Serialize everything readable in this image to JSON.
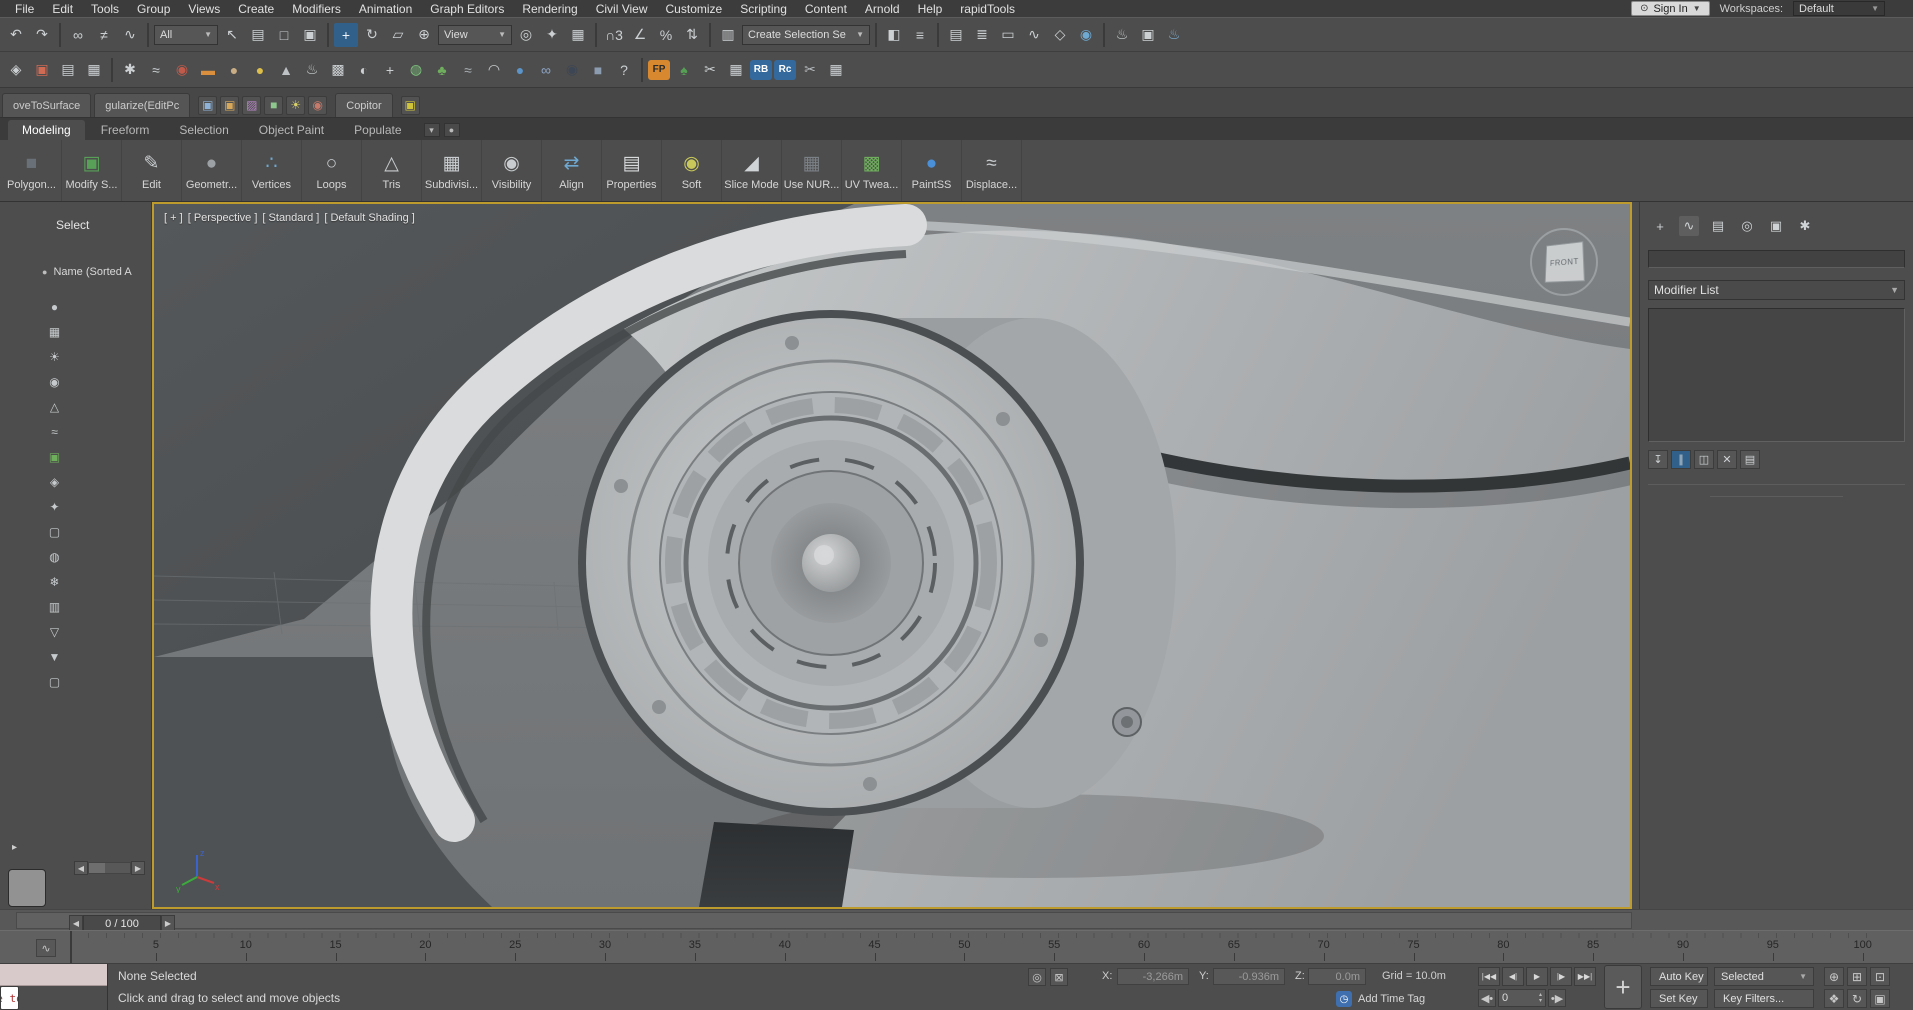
{
  "menu_bar": {
    "items": [
      "File",
      "Edit",
      "Tools",
      "Group",
      "Views",
      "Create",
      "Modifiers",
      "Animation",
      "Graph Editors",
      "Rendering",
      "Civil View",
      "Customize",
      "Scripting",
      "Content",
      "Arnold",
      "Help",
      "rapidTools"
    ],
    "sign_in_label": "Sign In",
    "workspaces_label": "Workspaces:",
    "workspace_value": "Default"
  },
  "toolbar_row1": {
    "icons_a": [
      {
        "name": "undo-icon",
        "glyph": "↶"
      },
      {
        "name": "redo-icon",
        "glyph": "↷"
      },
      {
        "name": "separator",
        "kind": "sep",
        "inter": "false"
      },
      {
        "name": "select-and-link-icon",
        "glyph": "∞"
      },
      {
        "name": "unlink-selection-icon",
        "glyph": "≠"
      },
      {
        "name": "bind-to-space-warp-icon",
        "glyph": "∿"
      },
      {
        "name": "separator",
        "kind": "sep",
        "inter": "false"
      }
    ],
    "filter_dropdown_value": "All",
    "icons_b": [
      {
        "name": "select-object-icon",
        "glyph": "↖"
      },
      {
        "name": "select-by-name-icon",
        "glyph": "▤"
      },
      {
        "name": "rectangular-selection-region-icon",
        "glyph": "□"
      },
      {
        "name": "window-crossing-icon",
        "glyph": "▣"
      },
      {
        "name": "separator",
        "kind": "sep",
        "inter": "false"
      },
      {
        "name": "select-and-move-icon",
        "glyph": "+",
        "kind": "hl"
      },
      {
        "name": "select-and-rotate-icon",
        "glyph": "↻"
      },
      {
        "name": "select-and-scale-icon",
        "glyph": "▱"
      },
      {
        "name": "select-and-place-icon",
        "glyph": "⊕"
      }
    ],
    "coord_dropdown_value": "View",
    "icons_c": [
      {
        "name": "use-pivot-center-icon",
        "glyph": "◎"
      },
      {
        "name": "select-and-manipulate-icon",
        "glyph": "✦"
      },
      {
        "name": "keyboard-override-icon",
        "glyph": "▦"
      },
      {
        "name": "separator",
        "kind": "sep",
        "inter": "false"
      },
      {
        "name": "snaps-toggle-icon",
        "glyph": "∩3"
      },
      {
        "name": "angle-snap-icon",
        "glyph": "∠"
      },
      {
        "name": "percent-snap-icon",
        "glyph": "%"
      },
      {
        "name": "spinner-snap-icon",
        "glyph": "⇅"
      },
      {
        "name": "separator",
        "kind": "sep",
        "inter": "false"
      },
      {
        "name": "edit-named-selection-sets-icon",
        "glyph": "▥"
      }
    ],
    "sets_dropdown_value": "Create Selection Se",
    "icons_d": [
      {
        "name": "separator",
        "kind": "sep",
        "inter": "false"
      },
      {
        "name": "mirror-icon",
        "glyph": "◧"
      },
      {
        "name": "align-icon",
        "glyph": "≡"
      },
      {
        "name": "separator",
        "kind": "sep",
        "inter": "false"
      },
      {
        "name": "scene-explorer-toggle-icon",
        "glyph": "▤"
      },
      {
        "name": "layer-explorer-toggle-icon",
        "glyph": "≣"
      },
      {
        "name": "ribbon-toggle-icon",
        "glyph": "▭"
      },
      {
        "name": "curve-editor-icon",
        "glyph": "∿"
      },
      {
        "name": "schematic-view-icon",
        "glyph": "◇"
      },
      {
        "name": "material-editor-icon",
        "glyph": "◉",
        "style": "color:#6fa8d0"
      },
      {
        "name": "separator",
        "kind": "sep",
        "inter": "false"
      },
      {
        "name": "render-setup-icon",
        "glyph": "♨"
      },
      {
        "name": "rendered-frame-icon",
        "glyph": "▣"
      },
      {
        "name": "render-production-icon",
        "glyph": "♨",
        "style": "color:#7fb3d8"
      }
    ]
  },
  "toolbar_row2": {
    "icons": [
      {
        "name": "snapshot-icon",
        "glyph": "◈"
      },
      {
        "name": "image-viewer-icon",
        "glyph": "▣",
        "style": "color:#cf6a55"
      },
      {
        "name": "grid-array-icon",
        "glyph": "▤"
      },
      {
        "name": "data-table-icon",
        "glyph": "▦"
      },
      {
        "name": "separator",
        "kind": "sep",
        "inter": "false"
      },
      {
        "name": "gear-icon",
        "glyph": "✱"
      },
      {
        "name": "particles-icon",
        "glyph": "≈"
      },
      {
        "name": "camera-icon",
        "glyph": "◉",
        "style": "color:#c05a4a"
      },
      {
        "name": "rectangle-shape-icon",
        "glyph": "▬",
        "style": "color:#d98f3e"
      },
      {
        "name": "sphere-shape-icon",
        "glyph": "●",
        "style": "color:#c9ad85"
      },
      {
        "name": "circle-shape-icon",
        "glyph": "●",
        "style": "color:#ddbe4a"
      },
      {
        "name": "cone-shape-icon",
        "glyph": "▲",
        "style": "color:#bfc2c4"
      },
      {
        "name": "teapot-icon",
        "glyph": "♨"
      },
      {
        "name": "lattice-icon",
        "glyph": "▩"
      },
      {
        "name": "dark-sphere-icon",
        "glyph": "◐"
      },
      {
        "name": "axis-gizmo-icon",
        "glyph": "+"
      },
      {
        "name": "globe-icon",
        "glyph": "◍",
        "style": "color:#7ec37e"
      },
      {
        "name": "plant-icon",
        "glyph": "♣",
        "style": "color:#6fae5d"
      },
      {
        "name": "smoke-icon",
        "glyph": "≈",
        "style": "color:#aab0b4"
      },
      {
        "name": "swirl-icon",
        "glyph": "◠"
      },
      {
        "name": "blue-sphere-icon",
        "glyph": "●",
        "style": "color:#5b94c8"
      },
      {
        "name": "chain-icon",
        "glyph": "∞",
        "style": "color:#8fa6c8"
      },
      {
        "name": "eye-icon",
        "glyph": "◉",
        "style": "color:#3c4654"
      },
      {
        "name": "cube-icon",
        "glyph": "■",
        "style": "color:#8b9bb0"
      },
      {
        "name": "help-icon",
        "glyph": "?"
      },
      {
        "name": "separator",
        "kind": "sep",
        "inter": "false"
      },
      {
        "name": "forest-pack-badge",
        "kind": "badge",
        "glyph": "FP",
        "style": "background:#d8882f;color:#2b2b2b"
      },
      {
        "name": "tree-icon",
        "glyph": "♠",
        "style": "color:#55a055"
      },
      {
        "name": "scissors-icon",
        "glyph": "✂"
      },
      {
        "name": "uv-grid-icon",
        "glyph": "▦"
      },
      {
        "name": "railclone-badge",
        "kind": "badge",
        "glyph": "RB",
        "style": "background:#34699e;color:#ffffff"
      },
      {
        "name": "railclone-color-badge",
        "kind": "badge",
        "glyph": "Rc",
        "style": "background:#34699e;color:#ffffff"
      },
      {
        "name": "cutter-icon",
        "glyph": "✂",
        "style": "color:#b8bcbe"
      },
      {
        "name": "spreadsheet-icon",
        "glyph": "▦"
      }
    ]
  },
  "tab_bar": {
    "doc_tabs": [
      {
        "name": "tab-movetosurface",
        "label": "oveToSurface"
      },
      {
        "name": "tab-regularize-editpoly",
        "label": "gularize(EditPc"
      }
    ],
    "tool_icons": [
      {
        "name": "copy-tool-icon",
        "glyph": "▣",
        "style": "color:#8fb3d8"
      },
      {
        "name": "paste-tool-icon",
        "glyph": "▣",
        "style": "color:#d8a85a"
      },
      {
        "name": "material-tool-icon",
        "glyph": "▨",
        "style": "color:#b886c8"
      },
      {
        "name": "geometry-tool-icon",
        "glyph": "■",
        "style": "color:#8fc88f"
      },
      {
        "name": "light-tool-icon",
        "glyph": "☀",
        "style": "color:#d8d06a"
      },
      {
        "name": "camera-tool-icon",
        "glyph": "◉",
        "style": "color:#c87a6a"
      }
    ],
    "copitor_tab_label": "Copitor",
    "trailing_icons": [
      {
        "name": "textool-icon",
        "glyph": "▣",
        "style": "color:#cfc43a"
      }
    ]
  },
  "ribbon": {
    "tabs": [
      {
        "label": "Modeling",
        "state": "active"
      },
      {
        "label": "Freeform"
      },
      {
        "label": "Selection"
      },
      {
        "label": "Object Paint"
      },
      {
        "label": "Populate"
      }
    ],
    "options_icon_glyph": "▾",
    "minimize_icon_glyph": "●",
    "buttons": [
      {
        "name": "ribbon-button-polygon",
        "label": "Polygon...",
        "glyph": "■",
        "style": "color:#6a7077"
      },
      {
        "name": "ribbon-button-modify-selection",
        "label": "Modify S...",
        "glyph": "▣",
        "style": "color:#58a058"
      },
      {
        "name": "ribbon-button-edit",
        "label": "Edit",
        "glyph": "✎",
        "style": "color:#c8ccce"
      },
      {
        "name": "ribbon-button-geometry",
        "label": "Geometr...",
        "glyph": "●",
        "style": "color:#9ba1a5"
      },
      {
        "name": "ribbon-button-vertices",
        "label": "Vertices",
        "glyph": "∴",
        "style": "color:#6fa8d0"
      },
      {
        "name": "ribbon-button-loops",
        "label": "Loops",
        "glyph": "○",
        "style": "color:#c8ccce"
      },
      {
        "name": "ribbon-button-tris",
        "label": "Tris",
        "glyph": "△",
        "style": "color:#c8ccce"
      },
      {
        "name": "ribbon-button-subdivision",
        "label": "Subdivisi...",
        "glyph": "▦",
        "style": "color:#c8ccce"
      },
      {
        "name": "ribbon-button-visibility",
        "label": "Visibility",
        "glyph": "◉",
        "style": "color:#c8ccce"
      },
      {
        "name": "ribbon-button-align",
        "label": "Align",
        "glyph": "⇄",
        "style": "color:#6fa8d0"
      },
      {
        "name": "ribbon-button-properties",
        "label": "Properties",
        "glyph": "▤",
        "style": "color:#d8dadc"
      },
      {
        "name": "ribbon-button-soft",
        "label": "Soft",
        "glyph": "◉",
        "style": "color:#c8c85a"
      },
      {
        "name": "ribbon-button-slice-mode",
        "label": "Slice Mode",
        "glyph": "◢",
        "style": "color:#d0d4d6"
      },
      {
        "name": "ribbon-button-use-nurms",
        "label": "Use NUR...",
        "glyph": "▦",
        "style": "color:#7a8086"
      },
      {
        "name": "ribbon-button-uv-tweak",
        "label": "UV Twea...",
        "glyph": "▩",
        "style": "color:#6fae5d"
      },
      {
        "name": "ribbon-button-paintss",
        "label": "PaintSS",
        "glyph": "●",
        "style": "color:#4a90d9"
      },
      {
        "name": "ribbon-button-displace",
        "label": "Displace...",
        "glyph": "≈",
        "style": "color:#c8ccce"
      }
    ]
  },
  "scene_explorer": {
    "title": "Select",
    "header_dot_glyph": "●",
    "column_header": "Name (Sorted A",
    "rail_icons": [
      {
        "name": "sort-icon",
        "glyph": "●"
      },
      {
        "name": "display-geometry-icon",
        "glyph": "▦"
      },
      {
        "name": "display-lights-icon",
        "glyph": "☀"
      },
      {
        "name": "display-cameras-icon",
        "glyph": "◉"
      },
      {
        "name": "display-helpers-icon",
        "glyph": "△"
      },
      {
        "name": "display-spacewarps-icon",
        "glyph": "≈"
      },
      {
        "name": "display-groups-icon",
        "glyph": "▣",
        "style": "color:#6fae5d"
      },
      {
        "name": "display-xrefs-icon",
        "glyph": "◈"
      },
      {
        "name": "display-bones-icon",
        "glyph": "✦"
      },
      {
        "name": "display-containers-icon",
        "glyph": "▢"
      },
      {
        "name": "display-materials-icon",
        "glyph": "◍"
      },
      {
        "name": "display-frozen-icon",
        "glyph": "❄"
      },
      {
        "name": "display-hidden-icon",
        "glyph": "▥"
      },
      {
        "name": "funnel-filter-icon",
        "glyph": "▽"
      },
      {
        "name": "filter-config-icon",
        "glyph": "▼"
      },
      {
        "name": "pin-explorer-icon",
        "glyph": "▢"
      }
    ],
    "flyout_glyph": "▸",
    "scroll_left_glyph": "◀",
    "scroll_right_glyph": "▶"
  },
  "viewport": {
    "label_plus": "+",
    "label_view": "Perspective",
    "label_renderer": "Standard",
    "label_shading": "Default Shading",
    "viewcube_face": "FRONT",
    "axis_x": "x",
    "axis_y": "y",
    "axis_z": "z"
  },
  "command_panel": {
    "tabs": [
      {
        "name": "create-tab",
        "glyph": "+"
      },
      {
        "name": "modify-tab",
        "glyph": "∿",
        "state": "active"
      },
      {
        "name": "hierarchy-tab",
        "glyph": "▤"
      },
      {
        "name": "motion-tab",
        "glyph": "◎"
      },
      {
        "name": "display-tab",
        "glyph": "▣"
      },
      {
        "name": "utilities-tab",
        "glyph": "✱"
      }
    ],
    "modifier_list_label": "Modifier List",
    "dropdown_arrow": "▼",
    "stack_buttons": [
      {
        "name": "pin-stack-icon",
        "glyph": "↧"
      },
      {
        "name": "show-end-result-icon",
        "glyph": "∥",
        "kind": "hl"
      },
      {
        "name": "make-unique-icon",
        "glyph": "◫"
      },
      {
        "name": "remove-modifier-icon",
        "glyph": "✕"
      },
      {
        "name": "configure-modifier-sets-icon",
        "glyph": "▤"
      }
    ]
  },
  "track_bar": {
    "slider_label": "0 / 100",
    "prev_glyph": "◀",
    "next_glyph": "▶"
  },
  "ruler": {
    "trackbar_icon_glyph": "∿",
    "ticks": [
      "5",
      "10",
      "15",
      "20",
      "25",
      "30",
      "35",
      "40",
      "45",
      "50",
      "55",
      "60",
      "65",
      "70",
      "75",
      "80",
      "85",
      "90",
      "95",
      "100"
    ]
  },
  "status_bar": {
    "listener_text": "\"Time to sol",
    "selection_status": "None Selected",
    "prompt": "Click and drag to select and move objects",
    "mini_icons": [
      {
        "name": "isolate-selection-icon",
        "glyph": "◎"
      },
      {
        "name": "selection-lock-icon",
        "glyph": "⊠"
      }
    ],
    "x_label": "X:",
    "x_value": "-3,266m",
    "y_label": "Y:",
    "y_value": "-0.936m",
    "z_label": "Z:",
    "z_value": "0.0m",
    "grid_label": "Grid = 10.0m",
    "playback": [
      {
        "name": "go-to-start-button",
        "glyph": "|◀◀"
      },
      {
        "name": "previous-frame-button",
        "glyph": "◀|"
      },
      {
        "name": "play-button",
        "glyph": "▶"
      },
      {
        "name": "next-frame-button",
        "glyph": "|▶"
      },
      {
        "name": "go-to-end-button",
        "glyph": "▶▶|"
      }
    ],
    "plus_glyph": "+",
    "auto_key_label": "Auto Key",
    "selected_value": "Selected",
    "set_key_label": "Set Key",
    "key_filters_label": "Key Filters...",
    "clock_glyph": "◷",
    "add_time_tag_label": "Add Time Tag",
    "key_back_glyph": "◀•",
    "key_fwd_glyph": "•▶",
    "frame_value": "0",
    "nav_row1": [
      {
        "name": "zoom-icon",
        "glyph": "⊕"
      },
      {
        "name": "zoom-all-icon",
        "glyph": "⊞"
      },
      {
        "name": "zoom-extents-icon",
        "glyph": "⊡"
      }
    ],
    "nav_row2": [
      {
        "name": "pan-hand-icon",
        "glyph": "❖"
      },
      {
        "name": "orbit-icon",
        "glyph": "↻"
      },
      {
        "name": "maximize-viewport-icon",
        "glyph": "▣"
      }
    ]
  }
}
